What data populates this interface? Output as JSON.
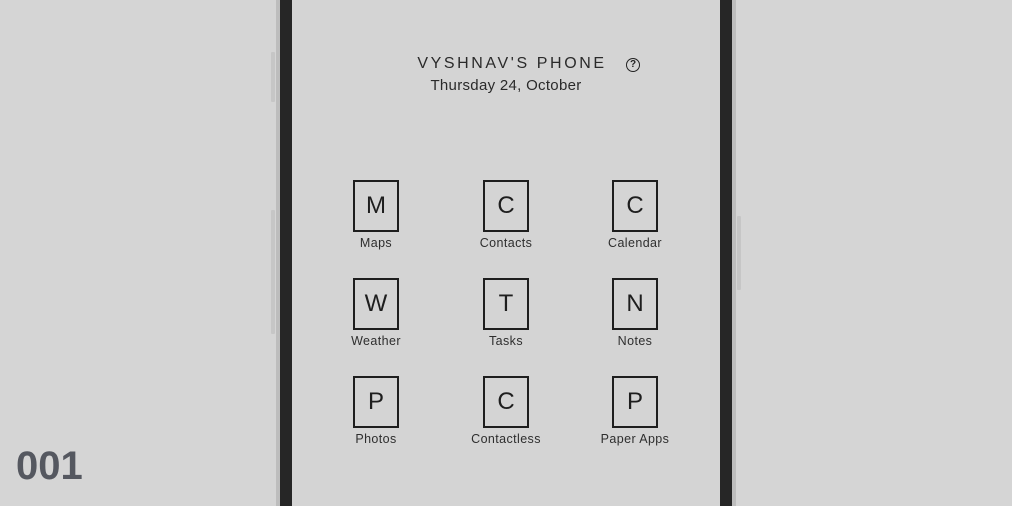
{
  "header": {
    "device_name": "VYSHNAV'S PHONE",
    "date": "Thursday 24, October",
    "help_icon": "question-circle-icon",
    "help_glyph": "?"
  },
  "apps": [
    {
      "letter": "M",
      "label": "Maps"
    },
    {
      "letter": "C",
      "label": "Contacts"
    },
    {
      "letter": "C",
      "label": "Calendar"
    },
    {
      "letter": "W",
      "label": "Weather"
    },
    {
      "letter": "T",
      "label": "Tasks"
    },
    {
      "letter": "N",
      "label": "Notes"
    },
    {
      "letter": "P",
      "label": "Photos"
    },
    {
      "letter": "C",
      "label": "Contactless"
    },
    {
      "letter": "P",
      "label": "Paper Apps"
    }
  ],
  "counter": "001",
  "colors": {
    "background": "#d5d5d5",
    "frame": "#262626",
    "text": "#2a2a2a",
    "counter": "#555860"
  }
}
